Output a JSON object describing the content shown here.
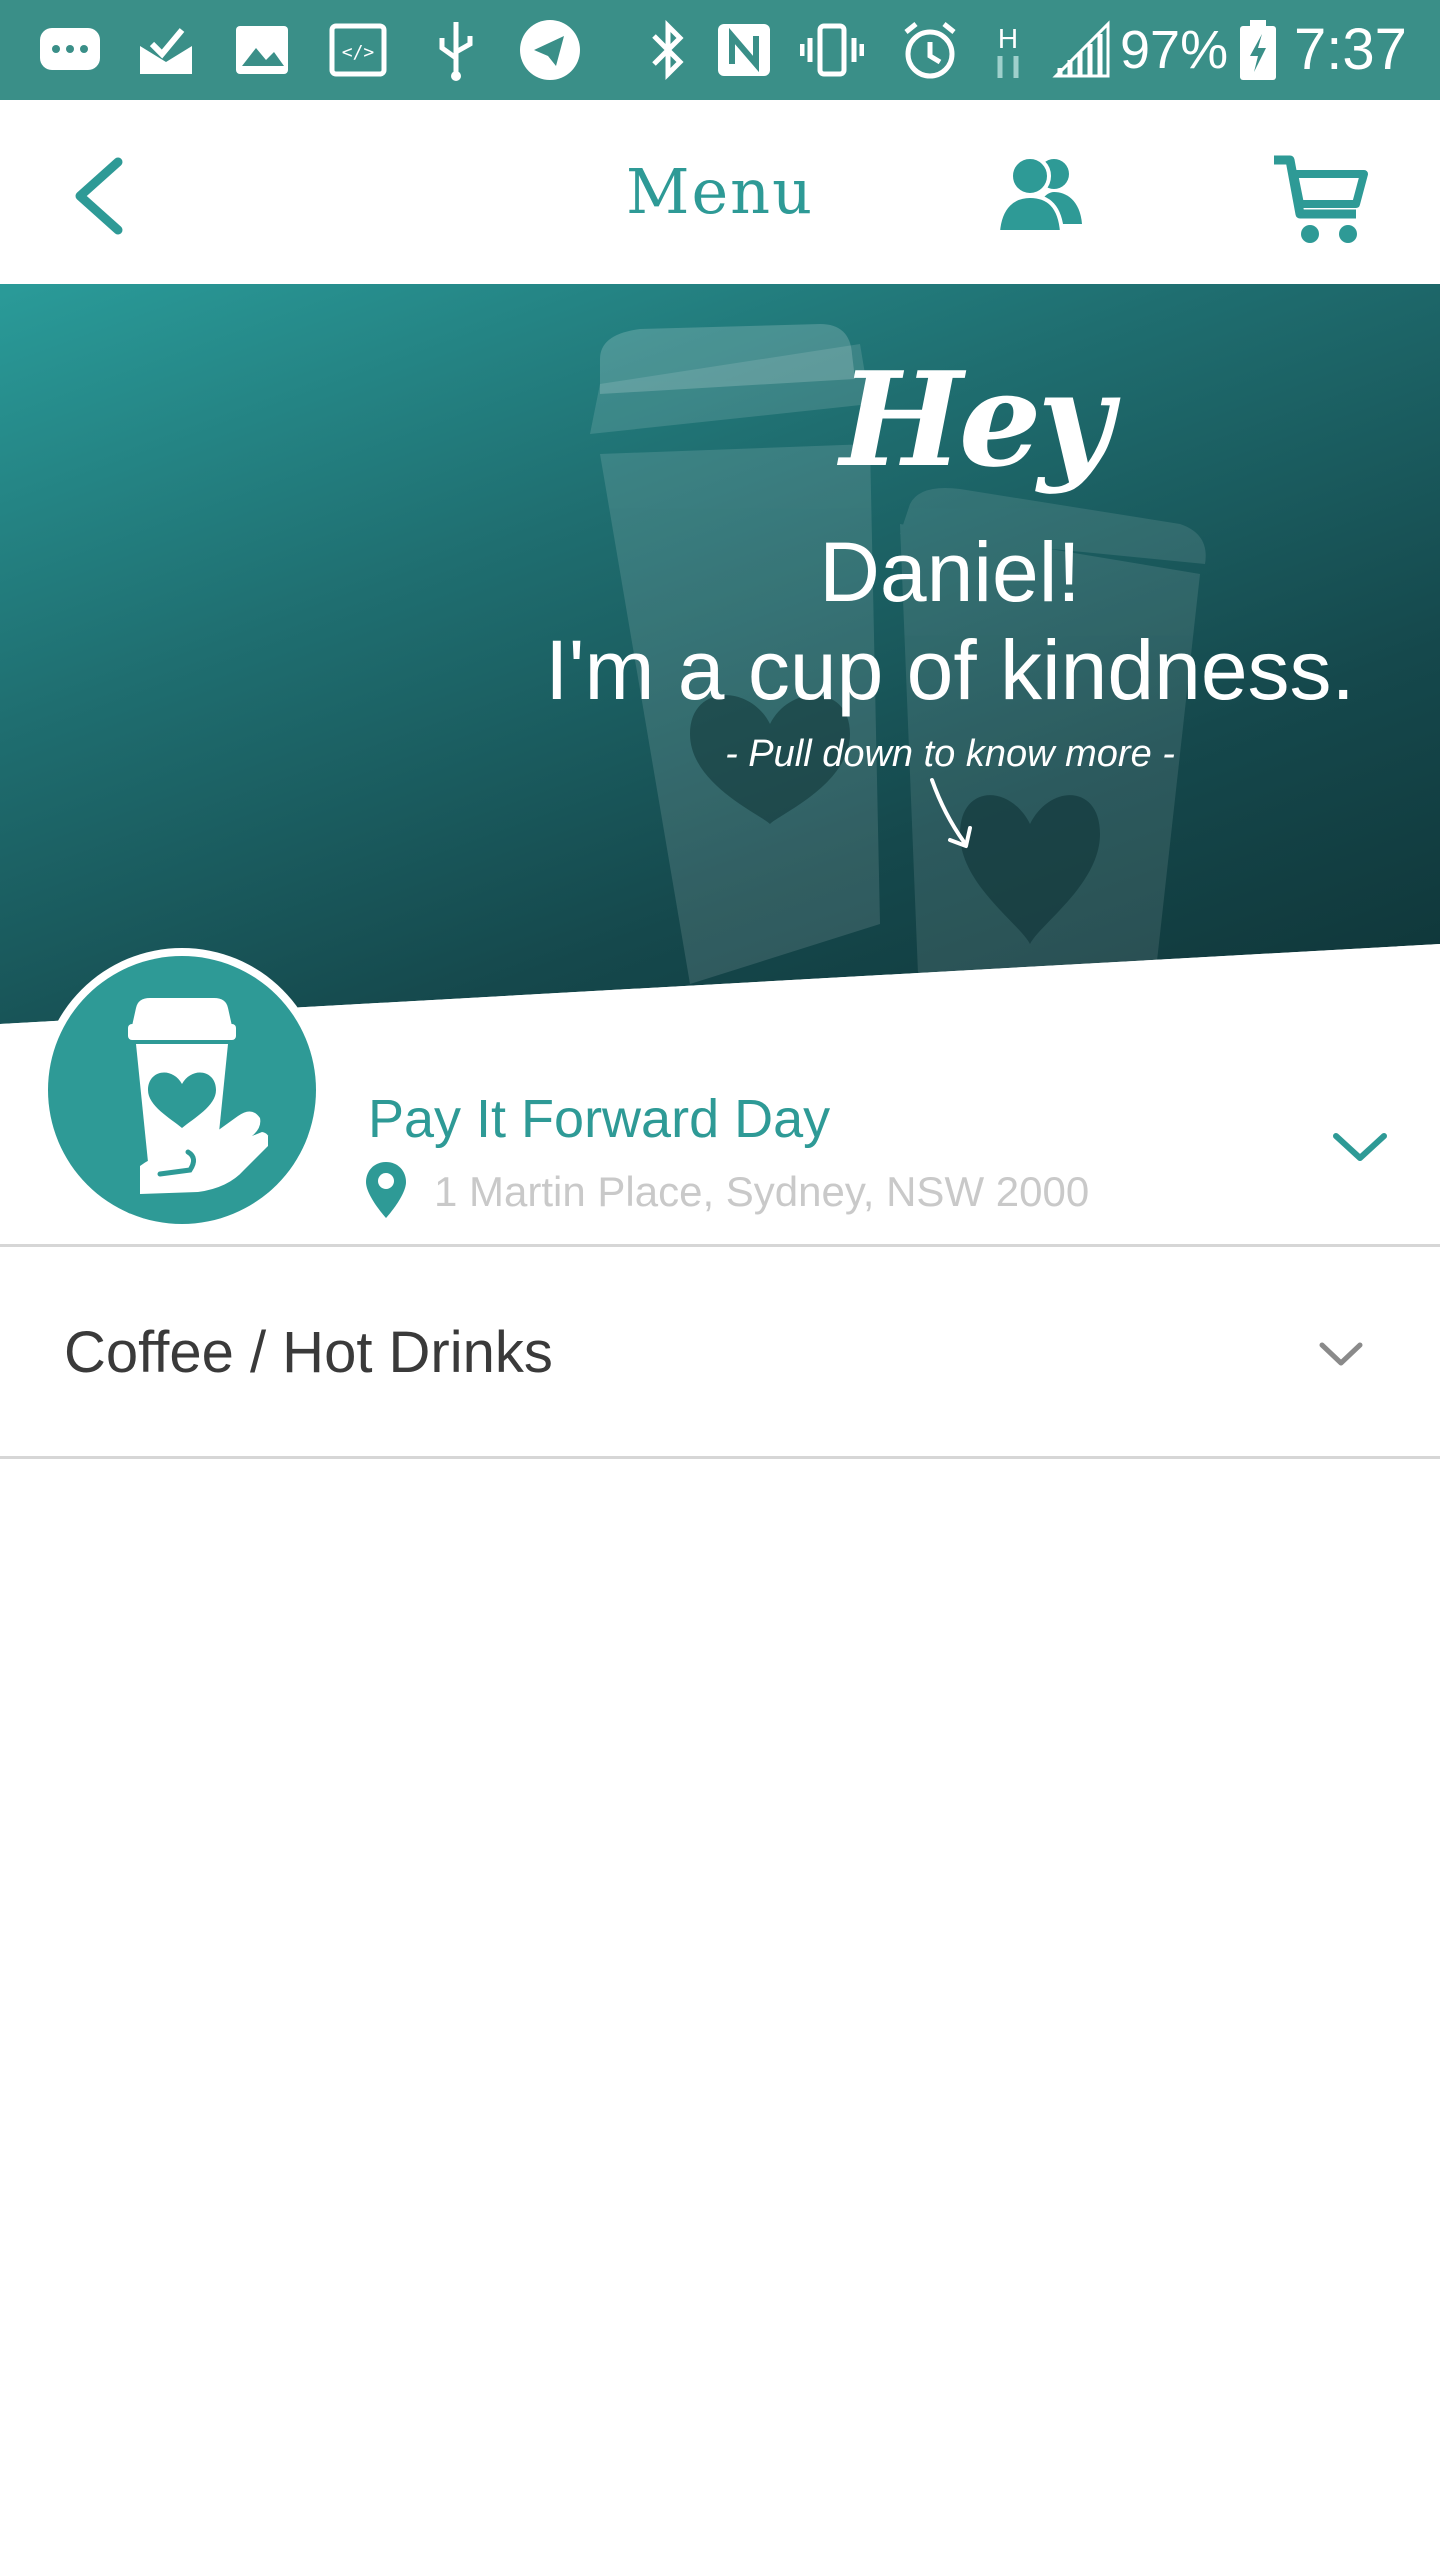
{
  "status_bar": {
    "icons": [
      "more-notification-icon",
      "mail-check-icon",
      "image-icon",
      "code-icon",
      "usb-icon",
      "telegram-icon",
      "bluetooth-icon",
      "nfc-icon",
      "vibrate-icon",
      "alarm-icon",
      "network-h-icon",
      "signal-icon",
      "battery-charging-icon"
    ],
    "battery_percent": "97%",
    "time": "7:37"
  },
  "header": {
    "title": "Menu",
    "back_icon": "chevron-left-icon",
    "people_icon": "people-icon",
    "cart_icon": "cart-icon"
  },
  "hero": {
    "hey": "Hey",
    "name_line": "Daniel!",
    "tagline": "I'm a cup of kindness.",
    "hint": "- Pull down to know more -"
  },
  "venue": {
    "name": "Pay It Forward Day",
    "address": "1 Martin Place, Sydney, NSW 2000",
    "logo_icon": "coffee-cup-heart-hand-icon"
  },
  "categories": [
    {
      "label": "Coffee / Hot Drinks"
    }
  ],
  "colors": {
    "status_bar": "#3a8f88",
    "accent": "#2e9a96",
    "hero_dark": "#0f3437",
    "address_text": "#c9c9c9",
    "category_text": "#3a3a3a"
  }
}
